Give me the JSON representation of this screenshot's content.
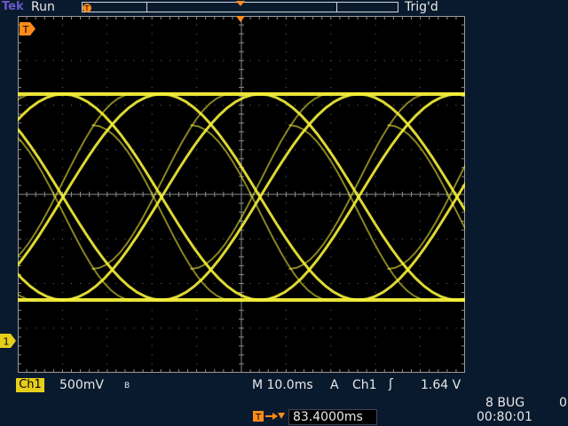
{
  "header": {
    "brand": "Tek",
    "run_state": "Run",
    "trigger_state": "Trig'd"
  },
  "channel": {
    "name": "Ch1",
    "volts_per_div": "500mV",
    "bandwidth_flag": "B",
    "marker_label": "1"
  },
  "timebase": {
    "horizontal": "M 10.0ms"
  },
  "trigger": {
    "mode": "A",
    "source": "Ch1",
    "slope_symbol": "ʃ",
    "level": "1.64 V",
    "marker_label": "T"
  },
  "delay": {
    "value": "83.4000ms"
  },
  "footer": {
    "label": "8 BUG",
    "count": "0",
    "clock": "00:80:01"
  },
  "colors": {
    "trace": "#f5f03a",
    "accent": "#ff8c1a",
    "background": "#0a1a2e",
    "grid": "#7a7a7a"
  }
}
